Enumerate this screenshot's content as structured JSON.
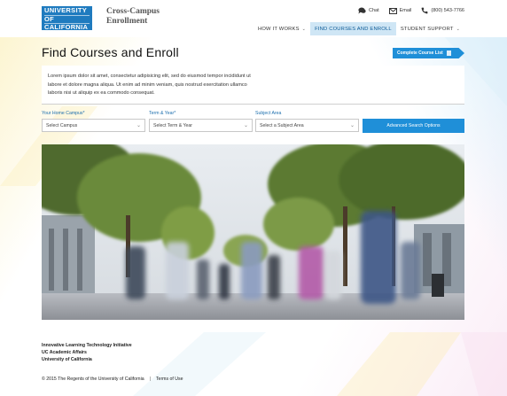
{
  "header": {
    "logo_lines": [
      "UNIVERSITY",
      "OF",
      "CALIFORNIA"
    ],
    "site_title_line1": "Cross-Campus",
    "site_title_line2": "Enrollment",
    "utility": {
      "chat": "Chat",
      "email": "Email",
      "phone": "(800) 543-7766"
    },
    "nav": [
      {
        "label": "HOW IT WORKS",
        "has_dropdown": true,
        "active": false
      },
      {
        "label": "FIND COURSES AND ENROLL",
        "has_dropdown": false,
        "active": true
      },
      {
        "label": "STUDENT SUPPORT",
        "has_dropdown": true,
        "active": false
      }
    ]
  },
  "main": {
    "page_title": "Find Courses and Enroll",
    "complete_list_label": "Complete Course List",
    "intro_text": "Lorem ipsum dolor sit amet, consectetur adipisicing elit, sed do eiusmod tempor incididunt ut labore et dolore magna aliqua. Ut enim ad minim veniam, quis nostrud exercitation ullamco laboris nisi ut aliquip ex ea commodo consequat.",
    "filters": {
      "campus_label": "Your Home Campus*",
      "campus_value": "Select Campus",
      "term_label": "Term & Year*",
      "term_value": "Select Term & Year",
      "subject_label": "Subject Area",
      "subject_value": "Select a Subject Area",
      "advanced_search_label": "Advanced Search Options"
    },
    "hero_image": "campus-walkway-students-photo"
  },
  "footer": {
    "org_line1": "Innovative Learning Technology Initiative",
    "org_line2": "UC Academic Affairs",
    "org_line3": "University of California",
    "copyright": "© 2015 The Regents of the University of California",
    "separator": "|",
    "terms_link": "Terms of Use"
  },
  "colors": {
    "brand_blue": "#1f7bbf",
    "button_blue": "#1f8fd8",
    "nav_active_bg": "#cfe6f5",
    "label_blue": "#1d6fae"
  }
}
